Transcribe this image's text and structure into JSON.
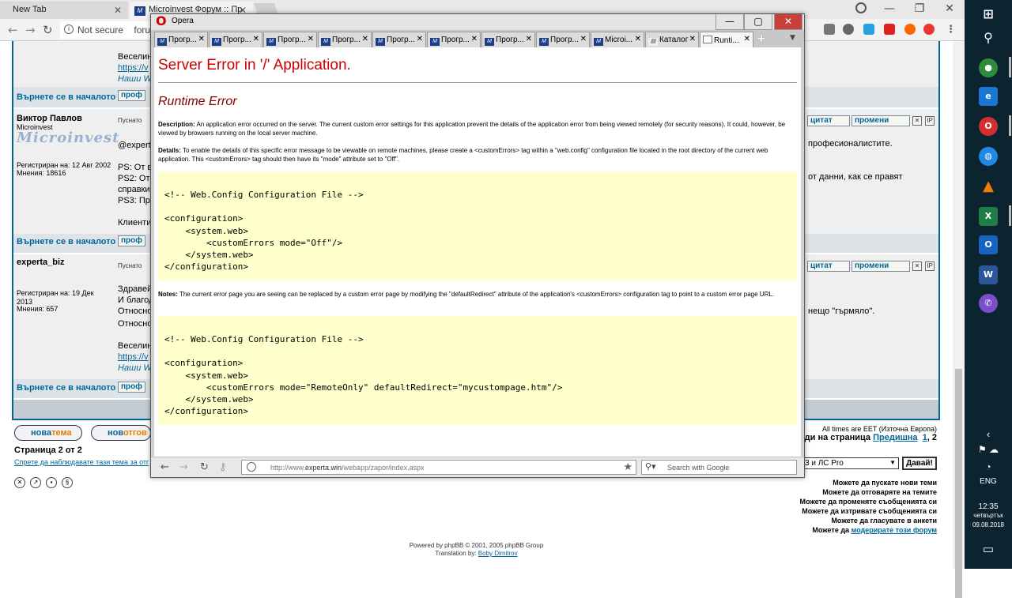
{
  "chrome": {
    "tabs": [
      {
        "label": "New Tab"
      },
      {
        "label": "Microinvest Форум :: Пр"
      }
    ],
    "omnibox": {
      "security": "Not secure",
      "url": "foru"
    },
    "window_controls": [
      "—",
      "❐",
      "✕"
    ]
  },
  "forum": {
    "back_to_top": "Върнете се в началото",
    "profile_btn": "проф",
    "quote_btn": "цитат",
    "edit_btn": "промени",
    "posted": "Пуснато",
    "logo_text": "Microinvest",
    "post1": {
      "lines": [
        "Веселин",
        "https://v",
        "Наши W"
      ]
    },
    "post2": {
      "author": "Виктор Павлов",
      "rank": "Microinvest",
      "registered": "Регистриран на: 12 Авг 2002",
      "posts_count": "Мнения: 18616",
      "lines": [
        "@expert",
        "PS: От в",
        "PS2: От",
        "справки",
        "PS3: Пре",
        "Клиенти"
      ],
      "right1": "професионалистите.",
      "right2": "от данни, как се правят"
    },
    "post3": {
      "author": "experta_biz",
      "registered": "Регистриран на: 19 Дек 2013",
      "posts_count": "Мнения: 657",
      "lines": [
        "Здравей",
        "И благод",
        "Относно",
        "Относно",
        "Веселин",
        "https://v",
        "Наши W"
      ],
      "right1": "нещо \"гърмяло\"."
    },
    "new_topic": {
      "a": "нова",
      "b": "тема"
    },
    "new_reply": {
      "a": "нов",
      "b": "отгов"
    },
    "timezone": "All times are EET (Източна Европа)",
    "goto_label": "Иди на страница",
    "goto_prev": "Предишна",
    "goto_p1": "1",
    "goto_p2": ", 2",
    "page_of": "Страница 2 от 2",
    "stop_watch": "Спрете да наблюдавате тази тема за отг",
    "jump_select": "3 и ЛС Pro",
    "jump_go": "Давай!",
    "permissions": [
      "Можете да пускате нови теми",
      "Можете да отговаряте на темите",
      "Можете да променяте съобщенията си",
      "Можете да изтривате съобщенията си",
      "Можете да гласувате в анкети"
    ],
    "perm_moderate_pre": "Можете да ",
    "perm_moderate_link": "модерирате този форум",
    "powered_by": "Powered by phpBB © 2001, 2005 phpBB Group",
    "translation_pre": "Translation by: ",
    "translation_link": "Boby Dimitrov"
  },
  "opera": {
    "menu_label": "Opera",
    "tabs": [
      "Прогр...",
      "Прогр...",
      "Прогр...",
      "Прогр...",
      "Прогр...",
      "Прогр...",
      "Прогр...",
      "Прогр...",
      "Microi...",
      "Каталог",
      "Runti..."
    ],
    "error": {
      "title": "Server Error in '/' Application.",
      "subtitle": "Runtime Error",
      "desc_label": "Description:",
      "desc_text": " An application error occurred on the server. The current custom error settings for this application prevent the details of the application error from being viewed remotely (for security reasons). It could, however, be viewed by browsers running on the local server machine.",
      "details_label": "Details:",
      "details_text": " To enable the details of this specific error message to be viewable on remote machines, please create a <customErrors> tag within a \"web.config\" configuration file located in the root directory of the current web application. This <customErrors> tag should then have its \"mode\" attribute set to \"Off\".",
      "code1": "<!-- Web.Config Configuration File -->\n\n<configuration>\n    <system.web>\n        <customErrors mode=\"Off\"/>\n    </system.web>\n</configuration>",
      "notes_label": "Notes:",
      "notes_text": " The current error page you are seeing can be replaced by a custom error page by modifying the \"defaultRedirect\" attribute of the application's <customErrors> configuration tag to point to a custom error page URL.",
      "code2": "<!-- Web.Config Configuration File -->\n\n<configuration>\n    <system.web>\n        <customErrors mode=\"RemoteOnly\" defaultRedirect=\"mycustompage.htm\"/>\n    </system.web>\n</configuration>"
    },
    "url_pre": "http://www.",
    "url_host": "experta.win",
    "url_path": "/webapp/zapor/index.aspx",
    "search_placeholder": "Search with Google"
  },
  "taskbar": {
    "language": "ENG",
    "time": "12:35",
    "day": "четвъртък",
    "date": "09.08.2018"
  },
  "colors": {
    "error_red": "#cc0000",
    "runtime_maroon": "#800000",
    "code_bg": "#ffffcc",
    "forum_link": "#006699",
    "taskbar_bg": "#0c2430"
  }
}
